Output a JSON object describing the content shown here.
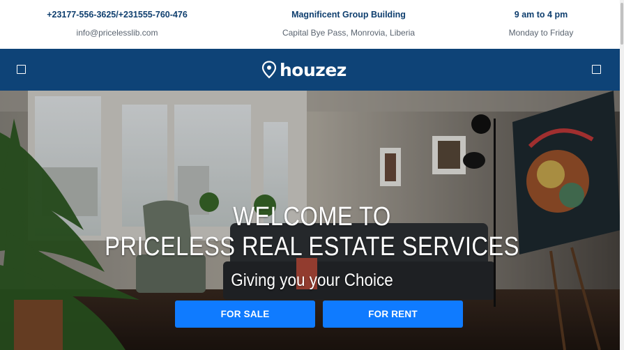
{
  "topbar": {
    "contact": {
      "phone": "+23177-556-3625/+231555-760-476",
      "email": "info@pricelesslib.com"
    },
    "address": {
      "building": "Magnificent Group Building",
      "location": "Capital Bye Pass, Monrovia, Liberia"
    },
    "hours": {
      "time": "9 am to 4 pm",
      "days": "Monday to Friday"
    }
  },
  "nav": {
    "logo_text": "houzez",
    "left_icon": "menu-icon",
    "right_icon": "user-icon"
  },
  "hero": {
    "title_line1": "WELCOME TO",
    "title_line2": "PRICELESS REAL ESTATE SERVICES",
    "subtitle": "Giving you your Choice",
    "buttons": {
      "sale": "FOR SALE",
      "rent": "FOR RENT"
    }
  },
  "colors": {
    "navbar": "#0e4377",
    "accent": "#0f7bff",
    "info_text": "#0e3e6e"
  }
}
